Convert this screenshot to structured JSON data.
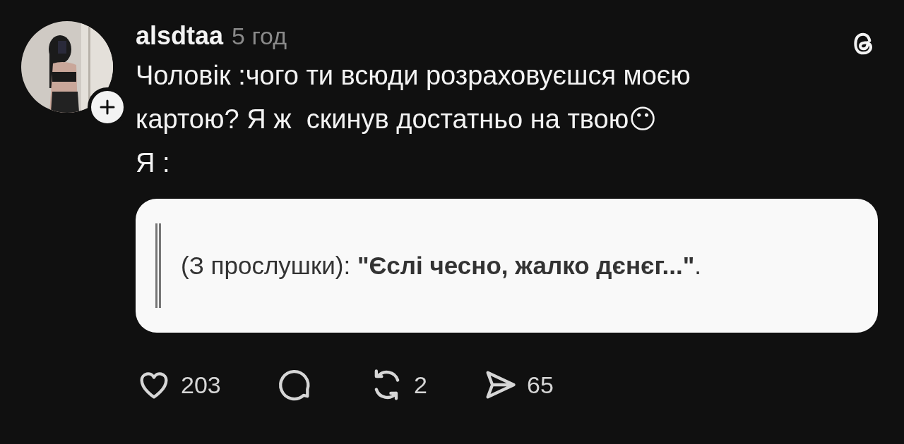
{
  "post": {
    "username": "alsdtaa",
    "time": "5 год",
    "text_lines": [
      "Чоловік :чого ти всюди розраховуєшся моєю",
      "картою? Я ж  скинув достатньо на твою😶",
      "Я :"
    ],
    "quote": "(З прослушки): **\"Єслі чесно, жалко дєнєг...\"**.",
    "actions": [
      {
        "kind": "like",
        "count": "203"
      },
      {
        "kind": "comment"
      },
      {
        "kind": "repost",
        "count": "2"
      },
      {
        "kind": "share",
        "count": "65"
      }
    ]
  }
}
